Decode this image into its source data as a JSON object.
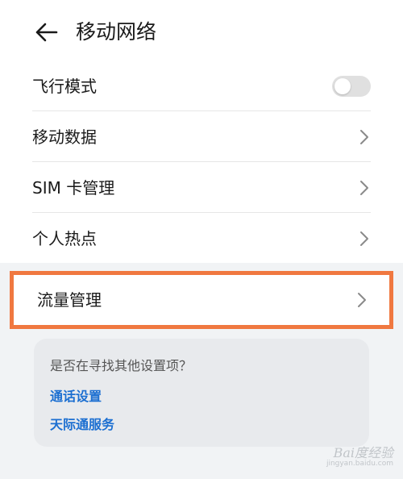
{
  "header": {
    "title": "移动网络"
  },
  "items": [
    {
      "label": "飞行模式",
      "control": "toggle",
      "toggle_on": false
    },
    {
      "label": "移动数据",
      "control": "chevron"
    },
    {
      "label": "SIM 卡管理",
      "control": "chevron"
    },
    {
      "label": "个人热点",
      "control": "chevron"
    }
  ],
  "highlighted_item": {
    "label": "流量管理",
    "control": "chevron",
    "highlight_color": "#f07840"
  },
  "suggestions": {
    "title": "是否在寻找其他设置项？",
    "links": [
      {
        "label": "通话设置"
      },
      {
        "label": "天际通服务"
      }
    ],
    "link_color": "#1c6fd1"
  },
  "watermark": {
    "text": "Bai度经验",
    "sub": "jingyan.baidu.com"
  },
  "icons": {
    "back": "arrow-left-icon",
    "chevron": "chevron-right-icon"
  }
}
